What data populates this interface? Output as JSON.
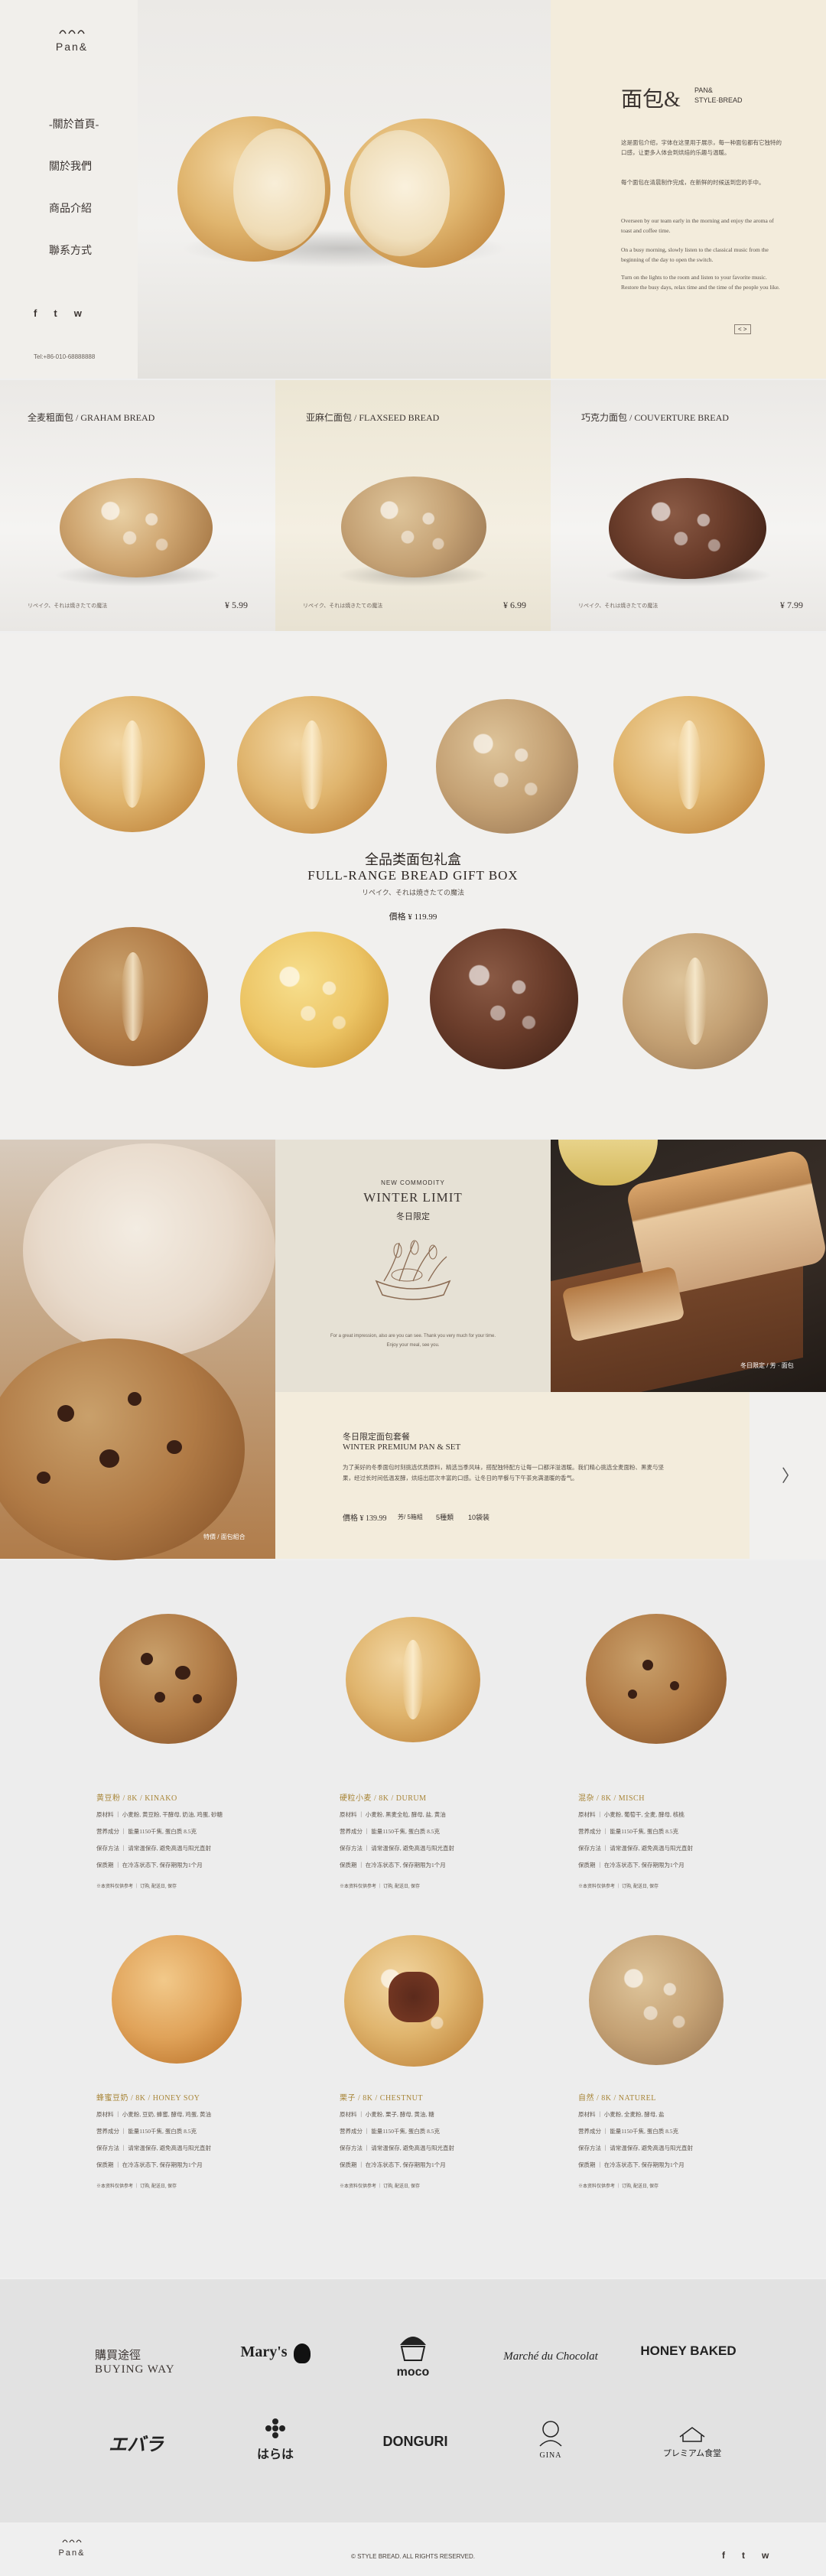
{
  "sidebar": {
    "logo": "Pan&",
    "nav": [
      "-關於首頁-",
      "關於我們",
      "商品介紹",
      "聯系方式"
    ],
    "tel": "Tel:+86-010-68888888"
  },
  "hero": {
    "title": "面包&",
    "subtitle_line1": "PAN&",
    "subtitle_line2": "STYLE·BREAD",
    "paragraphs": [
      "这是面包介绍，字体在这里用于展示，每一种面包都有它独特的口感，让更多人体会到烘焙的乐趣与温暖。",
      "每个面包在清晨制作完成，在新鲜的时候送到您的手中。",
      "Overseen by our team early in the morning and enjoy the aroma of toast and coffee time.",
      "On a busy morning, slowly listen to the classical music from the beginning of the day to open the switch.",
      "Turn on the lights to the room and listen to your favorite music. Restore the busy days, relax time and the time of the people you like."
    ],
    "pager": "< >"
  },
  "products": [
    {
      "name": "全麦粗面包 / GRAHAM BREAD",
      "caption": "リペイク、それは焼きたての魔法",
      "price": "¥ 5.99"
    },
    {
      "name": "亚麻仁面包 / FLAXSEED BREAD",
      "caption": "リペイク、それは焼きたての魔法",
      "price": "¥ 6.99"
    },
    {
      "name": "巧克力面包 / COUVERTURE BREAD",
      "caption": "リペイク、それは焼きたての魔法",
      "price": "¥ 7.99"
    }
  ],
  "giftbox": {
    "cn": "全品类面包礼盒",
    "en": "FULL-RANGE BREAD GIFT BOX",
    "jp": "リペイク、それは焼きたての魔法",
    "price_label": "價格 ¥ 119.99"
  },
  "winter": {
    "tag": "NEW COMMODITY",
    "title": "WINTER LIMIT",
    "cn": "冬日限定",
    "note1": "For a great impression, also are you can see. Thank you very much for your time.",
    "note2": "Enjoy your meal, see you.",
    "left_caption": "特價 / 面包組合",
    "right_caption": "冬日限定 / 芳 · 面包",
    "set_cn": "冬日限定面包套餐",
    "set_en": "WINTER PREMIUM PAN & SET",
    "set_desc": "为了美好的冬季面包时刻挑选优质原料，精选当季风味，搭配独特配方让每一口都洋溢温暖。我们精心挑选全麦面粉、黑麦与坚果，经过长时间低温发酵，烘焙出层次丰富的口感。让冬日的早餐与下午茶充满温暖的香气。",
    "set_price": "價格 ¥ 139.99",
    "set_c1": "芳/ 5箱組",
    "set_c2": "5種類",
    "set_c3": "10袋装",
    "arrow": "〉"
  },
  "catalog": [
    {
      "title": "黄豆粉 / 8K / KINAKO",
      "rows": [
        "原材料 ｜ 小麦粉, 黄豆粉, 干酵母, 奶油, 鸡蛋, 砂糖",
        "营养成分 ｜ 能量1150千焦, 蛋白质 8.5克",
        "保存方法 ｜ 请常温保存, 避免高温与阳光直射",
        "保质期 ｜ 在冷冻状态下, 保存期限为1个月"
      ],
      "foot": "※本资料仅供参考 ｜ 订购, 配送日, 保存"
    },
    {
      "title": "硬粒小麦 / 8K / DURUM",
      "rows": [
        "原材料 ｜ 小麦粉, 黑麦全粒, 酵母, 盐, 黄油",
        "营养成分 ｜ 能量1150千焦, 蛋白质 8.5克",
        "保存方法 ｜ 请常温保存, 避免高温与阳光直射",
        "保质期 ｜ 在冷冻状态下, 保存期限为1个月"
      ],
      "foot": "※本资料仅供参考 ｜ 订购, 配送日, 保存"
    },
    {
      "title": "混杂 / 8K / MISCH",
      "rows": [
        "原材料 ｜ 小麦粉, 葡萄干, 全麦, 酵母, 核桃",
        "营养成分 ｜ 能量1150千焦, 蛋白质 8.5克",
        "保存方法 ｜ 请常温保存, 避免高温与阳光直射",
        "保质期 ｜ 在冷冻状态下, 保存期限为1个月"
      ],
      "foot": "※本资料仅供参考 ｜ 订购, 配送日, 保存"
    },
    {
      "title": "蜂蜜豆奶 / 8K / HONEY SOY",
      "rows": [
        "原材料 ｜ 小麦粉, 豆奶, 蜂蜜, 酵母, 鸡蛋, 黄油",
        "营养成分 ｜ 能量1150千焦, 蛋白质 8.5克",
        "保存方法 ｜ 请常温保存, 避免高温与阳光直射",
        "保质期 ｜ 在冷冻状态下, 保存期限为1个月"
      ],
      "foot": "※本资料仅供参考 ｜ 订购, 配送日, 保存"
    },
    {
      "title": "栗子 / 8K / CHESTNUT",
      "rows": [
        "原材料 ｜ 小麦粉, 栗子, 酵母, 黄油, 糖",
        "营养成分 ｜ 能量1150千焦, 蛋白质 8.5克",
        "保存方法 ｜ 请常温保存, 避免高温与阳光直射",
        "保质期 ｜ 在冷冻状态下, 保存期限为1个月"
      ],
      "foot": "※本资料仅供参考 ｜ 订购, 配送日, 保存"
    },
    {
      "title": "自然 / 8K / NATUREL",
      "rows": [
        "原材料 ｜ 小麦粉, 全麦粉, 酵母, 盐",
        "营养成分 ｜ 能量1150千焦, 蛋白质 8.5克",
        "保存方法 ｜ 请常温保存, 避免高温与阳光直射",
        "保质期 ｜ 在冷冻状态下, 保存期限为1个月"
      ],
      "foot": "※本资料仅供参考 ｜ 订购, 配送日, 保存"
    }
  ],
  "brands": {
    "title_cn": "購買途徑",
    "title_en": "BUYING WAY",
    "row1": [
      "Mary's",
      "moco",
      "Marché du Chocolat",
      "HONEY BAKED"
    ],
    "row2": [
      "エバラ",
      "はらは",
      "DONGURI",
      "GINA",
      "プレミアム食堂"
    ]
  },
  "footer": {
    "logo": "Pan&",
    "copyright": "© STYLE BREAD. ALL RIGHTS RESERVED."
  },
  "social": [
    "f",
    "t",
    "w"
  ],
  "colors": {
    "cream": "#f3ecdc",
    "accent": "#a88537",
    "dark": "#2b2420"
  }
}
